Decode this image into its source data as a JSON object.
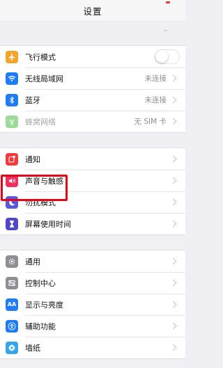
{
  "header": {
    "title": "设置"
  },
  "colors": {
    "airplane": "#f4a32b",
    "wifi": "#1f7cf5",
    "bluetooth": "#1f7cf5",
    "cellular": "#9edb9b",
    "notifications": "#ee3b3b",
    "sounds": "#ef2f5e",
    "dnd": "#5b58d6",
    "screen_time": "#4f48c8",
    "general": "#8e8e93",
    "control_center": "#8e8e93",
    "display": "#1f7cf5",
    "accessibility": "#1f7cf5",
    "wallpaper": "#35a7e8",
    "highlight": "#e3061b"
  },
  "group1": {
    "airplane_label": "飞行模式",
    "wifi_label": "无线局域网",
    "wifi_value": "未连接",
    "bluetooth_label": "蓝牙",
    "bluetooth_value": "未连接",
    "cellular_label": "蜂窝网络",
    "cellular_value": "无 SIM 卡"
  },
  "group2": {
    "notifications_label": "通知",
    "sounds_label": "声音与触感",
    "dnd_label": "勿扰模式",
    "screen_time_label": "屏幕使用时间"
  },
  "group3": {
    "general_label": "通用",
    "control_center_label": "控制中心",
    "display_label": "显示与亮度",
    "display_icon_text": "AA",
    "accessibility_label": "辅助功能",
    "wallpaper_label": "墙纸"
  }
}
